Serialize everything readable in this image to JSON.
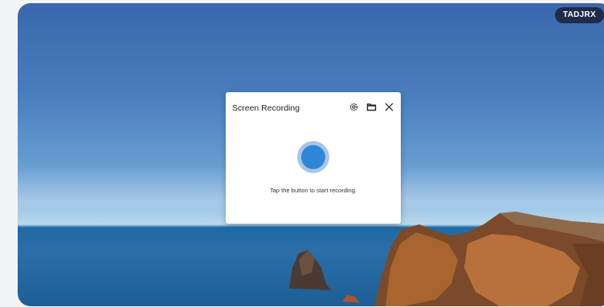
{
  "tag": {
    "label": "TADJRX"
  },
  "dialog": {
    "title": "Screen Recording",
    "hint": "Tap the button to start recording.",
    "icons": [
      "gear-icon",
      "folder-icon",
      "close-icon"
    ]
  }
}
